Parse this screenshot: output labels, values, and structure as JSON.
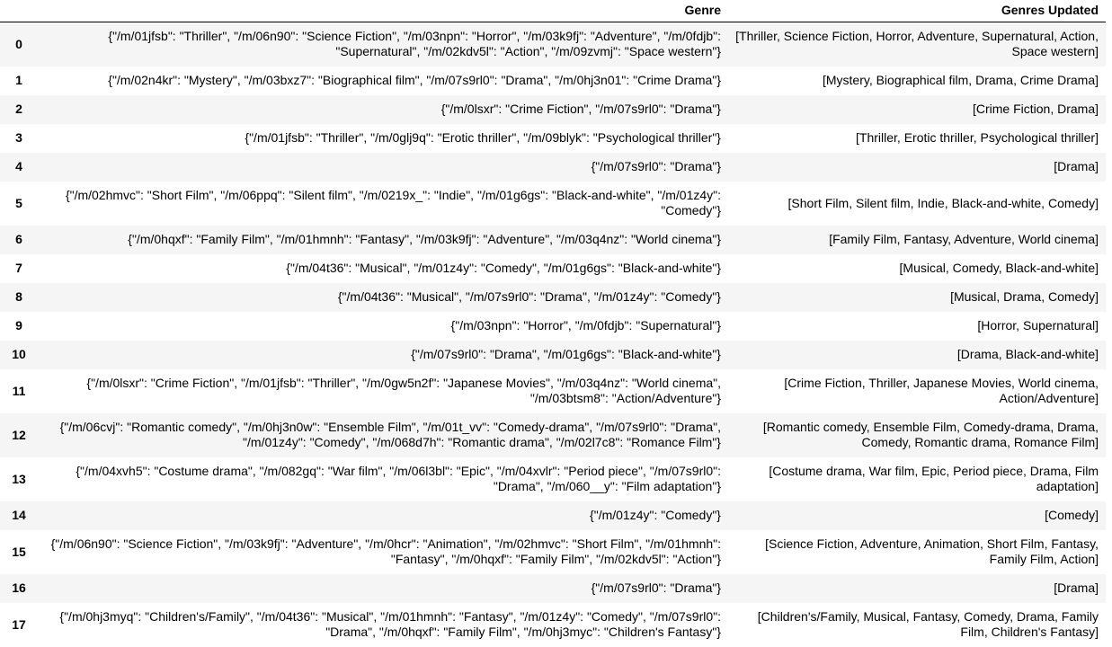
{
  "table": {
    "index_header": "",
    "columns": [
      "Genre",
      "Genres Updated"
    ],
    "rows": [
      {
        "index": "0",
        "genre": "{\"/m/01jfsb\": \"Thriller\", \"/m/06n90\": \"Science Fiction\", \"/m/03npn\": \"Horror\", \"/m/03k9fj\": \"Adventure\", \"/m/0fdjb\": \"Supernatural\", \"/m/02kdv5l\": \"Action\", \"/m/09zvmj\": \"Space western\"}",
        "updated": "[Thriller, Science Fiction, Horror, Adventure, Supernatural, Action, Space western]"
      },
      {
        "index": "1",
        "genre": "{\"/m/02n4kr\": \"Mystery\", \"/m/03bxz7\": \"Biographical film\", \"/m/07s9rl0\": \"Drama\", \"/m/0hj3n01\": \"Crime Drama\"}",
        "updated": "[Mystery, Biographical film, Drama, Crime Drama]"
      },
      {
        "index": "2",
        "genre": "{\"/m/0lsxr\": \"Crime Fiction\", \"/m/07s9rl0\": \"Drama\"}",
        "updated": "[Crime Fiction, Drama]"
      },
      {
        "index": "3",
        "genre": "{\"/m/01jfsb\": \"Thriller\", \"/m/0glj9q\": \"Erotic thriller\", \"/m/09blyk\": \"Psychological thriller\"}",
        "updated": "[Thriller, Erotic thriller, Psychological thriller]"
      },
      {
        "index": "4",
        "genre": "{\"/m/07s9rl0\": \"Drama\"}",
        "updated": "[Drama]"
      },
      {
        "index": "5",
        "genre": "{\"/m/02hmvc\": \"Short Film\", \"/m/06ppq\": \"Silent film\", \"/m/0219x_\": \"Indie\", \"/m/01g6gs\": \"Black-and-white\", \"/m/01z4y\": \"Comedy\"}",
        "updated": "[Short Film, Silent film, Indie, Black-and-white, Comedy]"
      },
      {
        "index": "6",
        "genre": "{\"/m/0hqxf\": \"Family Film\", \"/m/01hmnh\": \"Fantasy\", \"/m/03k9fj\": \"Adventure\", \"/m/03q4nz\": \"World cinema\"}",
        "updated": "[Family Film, Fantasy, Adventure, World cinema]"
      },
      {
        "index": "7",
        "genre": "{\"/m/04t36\": \"Musical\", \"/m/01z4y\": \"Comedy\", \"/m/01g6gs\": \"Black-and-white\"}",
        "updated": "[Musical, Comedy, Black-and-white]"
      },
      {
        "index": "8",
        "genre": "{\"/m/04t36\": \"Musical\", \"/m/07s9rl0\": \"Drama\", \"/m/01z4y\": \"Comedy\"}",
        "updated": "[Musical, Drama, Comedy]"
      },
      {
        "index": "9",
        "genre": "{\"/m/03npn\": \"Horror\", \"/m/0fdjb\": \"Supernatural\"}",
        "updated": "[Horror, Supernatural]"
      },
      {
        "index": "10",
        "genre": "{\"/m/07s9rl0\": \"Drama\", \"/m/01g6gs\": \"Black-and-white\"}",
        "updated": "[Drama, Black-and-white]"
      },
      {
        "index": "11",
        "genre": "{\"/m/0lsxr\": \"Crime Fiction\", \"/m/01jfsb\": \"Thriller\", \"/m/0gw5n2f\": \"Japanese Movies\", \"/m/03q4nz\": \"World cinema\", \"/m/03btsm8\": \"Action/Adventure\"}",
        "updated": "[Crime Fiction, Thriller, Japanese Movies, World cinema, Action/Adventure]"
      },
      {
        "index": "12",
        "genre": "{\"/m/06cvj\": \"Romantic comedy\", \"/m/0hj3n0w\": \"Ensemble Film\", \"/m/01t_vv\": \"Comedy-drama\", \"/m/07s9rl0\": \"Drama\", \"/m/01z4y\": \"Comedy\", \"/m/068d7h\": \"Romantic drama\", \"/m/02l7c8\": \"Romance Film\"}",
        "updated": "[Romantic comedy, Ensemble Film, Comedy-drama, Drama, Comedy, Romantic drama, Romance Film]"
      },
      {
        "index": "13",
        "genre": "{\"/m/04xvh5\": \"Costume drama\", \"/m/082gq\": \"War film\", \"/m/06l3bl\": \"Epic\", \"/m/04xvlr\": \"Period piece\", \"/m/07s9rl0\": \"Drama\", \"/m/060__y\": \"Film adaptation\"}",
        "updated": "[Costume drama, War film, Epic, Period piece, Drama, Film adaptation]"
      },
      {
        "index": "14",
        "genre": "{\"/m/01z4y\": \"Comedy\"}",
        "updated": "[Comedy]"
      },
      {
        "index": "15",
        "genre": "{\"/m/06n90\": \"Science Fiction\", \"/m/03k9fj\": \"Adventure\", \"/m/0hcr\": \"Animation\", \"/m/02hmvc\": \"Short Film\", \"/m/01hmnh\": \"Fantasy\", \"/m/0hqxf\": \"Family Film\", \"/m/02kdv5l\": \"Action\"}",
        "updated": "[Science Fiction, Adventure, Animation, Short Film, Fantasy, Family Film, Action]"
      },
      {
        "index": "16",
        "genre": "{\"/m/07s9rl0\": \"Drama\"}",
        "updated": "[Drama]"
      },
      {
        "index": "17",
        "genre": "{\"/m/0hj3myq\": \"Children's/Family\", \"/m/04t36\": \"Musical\", \"/m/01hmnh\": \"Fantasy\", \"/m/01z4y\": \"Comedy\", \"/m/07s9rl0\": \"Drama\", \"/m/0hqxf\": \"Family Film\", \"/m/0hj3myc\": \"Children's Fantasy\"}",
        "updated": "[Children's/Family, Musical, Fantasy, Comedy, Drama, Family Film, Children's Fantasy]"
      }
    ]
  }
}
